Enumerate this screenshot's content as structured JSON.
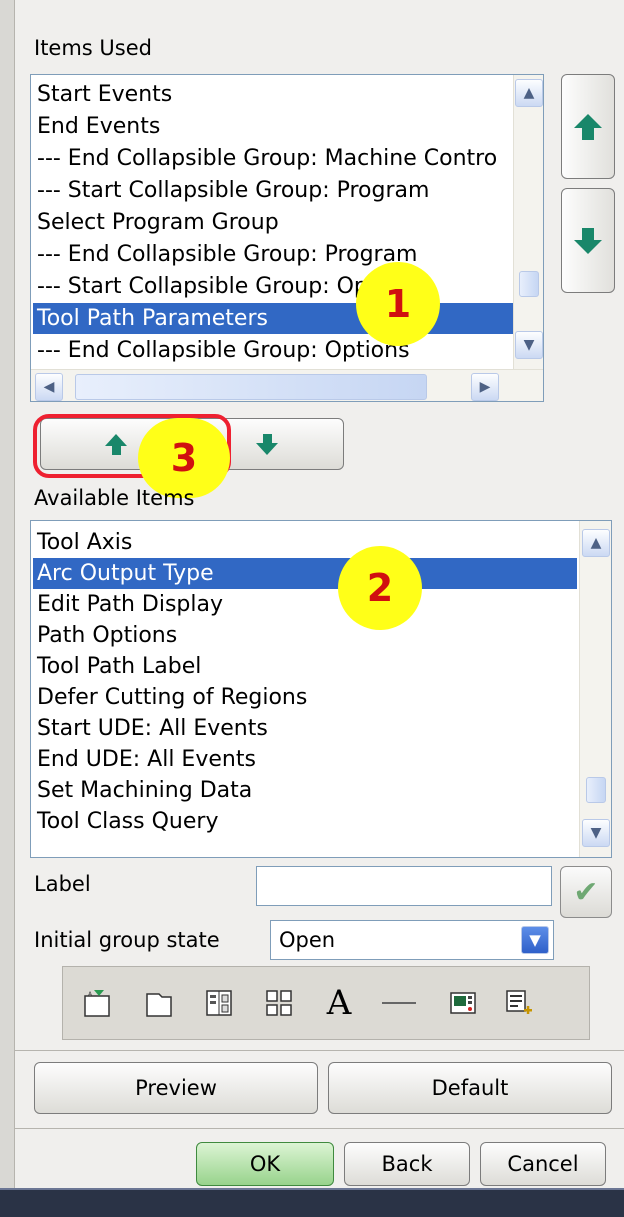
{
  "items_used": {
    "title": "Items Used",
    "items": [
      {
        "label": "Start Events",
        "selected": false
      },
      {
        "label": "End Events",
        "selected": false
      },
      {
        "label": "--- End Collapsible Group: Machine Contro",
        "selected": false
      },
      {
        "label": "--- Start Collapsible Group: Program",
        "selected": false
      },
      {
        "label": "Select Program Group",
        "selected": false
      },
      {
        "label": "--- End Collapsible Group: Program",
        "selected": false
      },
      {
        "label": "--- Start Collapsible Group: Options",
        "selected": false
      },
      {
        "label": "Tool Path Parameters",
        "selected": true
      },
      {
        "label": "--- End Collapsible Group: Options",
        "selected": false
      }
    ]
  },
  "available_items": {
    "title": "Available Items",
    "items": [
      {
        "label": "Tool Axis",
        "selected": false
      },
      {
        "label": "Arc Output Type",
        "selected": true
      },
      {
        "label": "Edit Path Display",
        "selected": false
      },
      {
        "label": "Path Options",
        "selected": false
      },
      {
        "label": "Tool Path Label",
        "selected": false
      },
      {
        "label": "Defer Cutting of Regions",
        "selected": false
      },
      {
        "label": "Start UDE: All Events",
        "selected": false
      },
      {
        "label": "End UDE: All Events",
        "selected": false
      },
      {
        "label": "Set Machining Data",
        "selected": false
      },
      {
        "label": "Tool Class Query",
        "selected": false
      }
    ]
  },
  "label_field": {
    "label": "Label",
    "value": ""
  },
  "initial_group_state": {
    "label": "Initial group state",
    "value": "Open"
  },
  "toolbar_icons": [
    "new-group-icon",
    "blank-page-icon",
    "list-panel-icon",
    "grid-icon",
    "text-icon",
    "separator-line-icon",
    "display-panel-icon",
    "add-list-icon"
  ],
  "toolbar_text_glyph": "A",
  "buttons": {
    "preview": "Preview",
    "default": "Default",
    "ok": "OK",
    "back": "Back",
    "cancel": "Cancel"
  },
  "annotations": [
    "1",
    "2",
    "3"
  ],
  "colors": {
    "selection": "#3168c4",
    "arrow": "#145a44",
    "badge": "#ffff18",
    "badge_text": "#d01010",
    "highlight": "#ee2030"
  }
}
